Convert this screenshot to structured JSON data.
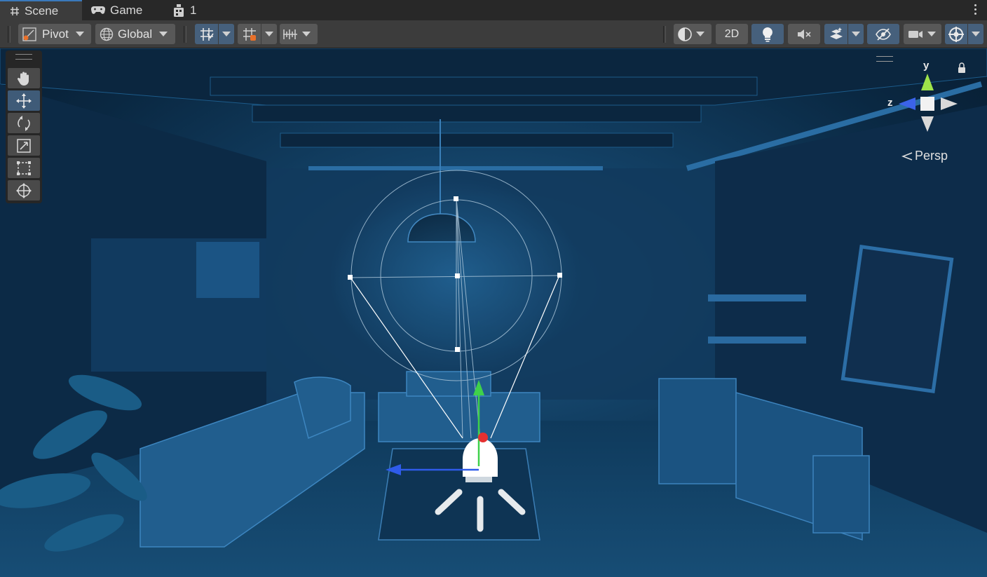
{
  "tabs": [
    {
      "label": "Scene",
      "active": true,
      "icon": "hash-icon"
    },
    {
      "label": "Game",
      "active": false,
      "icon": "gamepad-icon"
    },
    {
      "label": "1",
      "active": false,
      "icon": "hierarchy-node-icon"
    }
  ],
  "toolbar": {
    "pivot_label": "Pivot",
    "global_label": "Global",
    "mode_2d_label": "2D",
    "icons": [
      "pivot-icon",
      "globe-icon",
      "grid-snap-icon",
      "snap-increment-icon",
      "ruler-icon",
      "shading-mode-icon",
      "lightbulb-icon",
      "audio-mute-icon",
      "effects-icon",
      "visibility-icon",
      "camera-icon",
      "gizmos-icon"
    ]
  },
  "tools": [
    {
      "name": "hand-tool",
      "icon": "hand-icon",
      "active": false
    },
    {
      "name": "move-tool",
      "icon": "move-icon",
      "active": true
    },
    {
      "name": "rotate-tool",
      "icon": "rotate-icon",
      "active": false
    },
    {
      "name": "scale-tool",
      "icon": "scale-icon",
      "active": false
    },
    {
      "name": "rect-tool",
      "icon": "rect-icon",
      "active": false
    },
    {
      "name": "transform-tool",
      "icon": "transform-icon",
      "active": false
    }
  ],
  "gizmo": {
    "y_label": "y",
    "z_label": "z",
    "projection_label": "Persp"
  },
  "colors": {
    "accent": "#3a79bb",
    "toolbar_bg": "#3c3c3c",
    "active_btn": "#46607c",
    "axis_x": "#e53030",
    "axis_y": "#3fd14a",
    "axis_z": "#2f5bea"
  }
}
